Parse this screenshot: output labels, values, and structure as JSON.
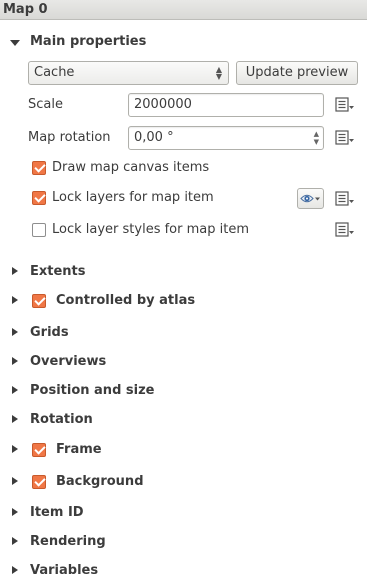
{
  "panel": {
    "title": "Map 0"
  },
  "main_properties": {
    "title": "Main properties",
    "cache_combo": {
      "value": "Cache"
    },
    "update_preview_label": "Update preview",
    "scale": {
      "label": "Scale",
      "value": "2000000"
    },
    "map_rotation": {
      "label": "Map rotation",
      "value": "0,00 °"
    },
    "draw_canvas_items": {
      "label": "Draw map canvas items",
      "checked": true
    },
    "lock_layers": {
      "label": "Lock layers for map item",
      "checked": true
    },
    "lock_layer_styles": {
      "label": "Lock layer styles for map item",
      "checked": false
    }
  },
  "groups": {
    "extents": "Extents",
    "controlled_by_atlas": "Controlled by atlas",
    "grids": "Grids",
    "overviews": "Overviews",
    "position_and_size": "Position and size",
    "rotation": "Rotation",
    "frame": "Frame",
    "background": "Background",
    "item_id": "Item ID",
    "rendering": "Rendering",
    "variables": "Variables"
  },
  "colors": {
    "checkbox_checked": "#f07746",
    "header_bg": "#dedede",
    "text": "#3c3c3c"
  },
  "icons": {
    "data_defined": "data-defined-override-icon",
    "eye": "eye-icon",
    "arrow_right": "expand-arrow-icon",
    "arrow_down": "collapse-arrow-icon"
  }
}
